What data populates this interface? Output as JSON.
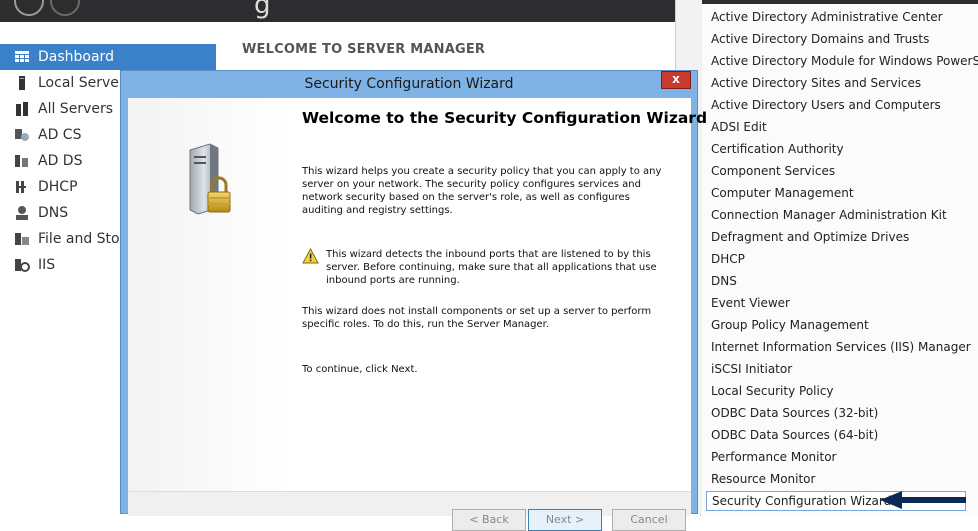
{
  "server_manager": {
    "sidebar": {
      "items": [
        {
          "label": "Dashboard",
          "icon": "dashboard-grid-icon",
          "active": true
        },
        {
          "label": "Local Server",
          "icon": "server-icon"
        },
        {
          "label": "All Servers",
          "icon": "servers-icon"
        },
        {
          "label": "AD CS",
          "icon": "certificate-server-icon"
        },
        {
          "label": "AD DS",
          "icon": "directory-server-icon"
        },
        {
          "label": "DHCP",
          "icon": "dhcp-icon"
        },
        {
          "label": "DNS",
          "icon": "dns-icon"
        },
        {
          "label": "File and Stora",
          "icon": "file-storage-icon"
        },
        {
          "label": "IIS",
          "icon": "iis-icon"
        }
      ]
    },
    "welcome_title": "WELCOME TO SERVER MANAGER"
  },
  "tools_menu": {
    "items": [
      "Active Directory Administrative Center",
      "Active Directory Domains and Trusts",
      "Active Directory Module for Windows PowerShell",
      "Active Directory Sites and Services",
      "Active Directory Users and Computers",
      "ADSI Edit",
      "Certification Authority",
      "Component Services",
      "Computer Management",
      "Connection Manager Administration Kit",
      "Defragment and Optimize Drives",
      "DHCP",
      "DNS",
      "Event Viewer",
      "Group Policy Management",
      "Internet Information Services (IIS) Manager",
      "iSCSI Initiator",
      "Local Security Policy",
      "ODBC Data Sources (32-bit)",
      "ODBC Data Sources (64-bit)",
      "Performance Monitor",
      "Resource Monitor",
      "Security Configuration Wizard"
    ],
    "highlighted": "Security Configuration Wizard"
  },
  "wizard": {
    "window_title": "Security Configuration Wizard",
    "close_glyph": "x",
    "heading": "Welcome to the Security Configuration Wizard",
    "para1": "This wizard helps you create a security policy that you can apply to any server on your network. The security policy configures services and network security based on the server's role, as well as configures auditing and registry settings.",
    "warning": "This wizard detects the inbound ports that are listened to by this server. Before continuing, make sure that all applications that use inbound ports are running.",
    "para2": "This wizard does not install components or set up a server to perform specific roles. To do this, run the Server Manager.",
    "para3": "To continue, click Next.",
    "buttons": {
      "back": "< Back",
      "next": "Next >",
      "cancel": "Cancel"
    }
  },
  "colors": {
    "accent": "#3a81c9",
    "wizard_frame": "#7fb2e5",
    "close_button": "#c83a2e",
    "arrow": "#0b2a55"
  }
}
